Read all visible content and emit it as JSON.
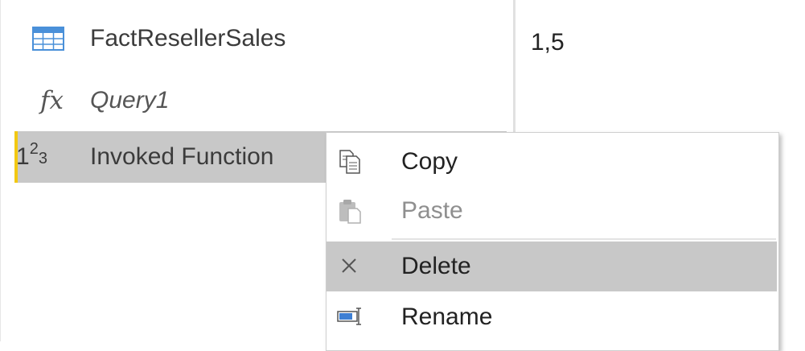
{
  "queries": {
    "items": [
      {
        "label": "FactResellerSales",
        "icon": "table-icon"
      },
      {
        "label": "Query1",
        "icon": "function-fx-icon"
      },
      {
        "label": "Invoked Function",
        "icon": "number-123-icon",
        "selected": true
      }
    ]
  },
  "preview": {
    "value": "1,5"
  },
  "context_menu": {
    "items": [
      {
        "label": "Copy",
        "icon": "copy-icon",
        "enabled": true
      },
      {
        "label": "Paste",
        "icon": "paste-icon",
        "enabled": false
      },
      {
        "label": "Delete",
        "icon": "close-x-icon",
        "enabled": true,
        "highlighted": true
      },
      {
        "label": "Rename",
        "icon": "rename-icon",
        "enabled": true
      }
    ]
  },
  "colors": {
    "selected_bg": "#c8c8c8",
    "selected_accent": "#f2c811",
    "disabled_text": "#8f8f8f",
    "table_icon_blue": "#4a90d9"
  }
}
